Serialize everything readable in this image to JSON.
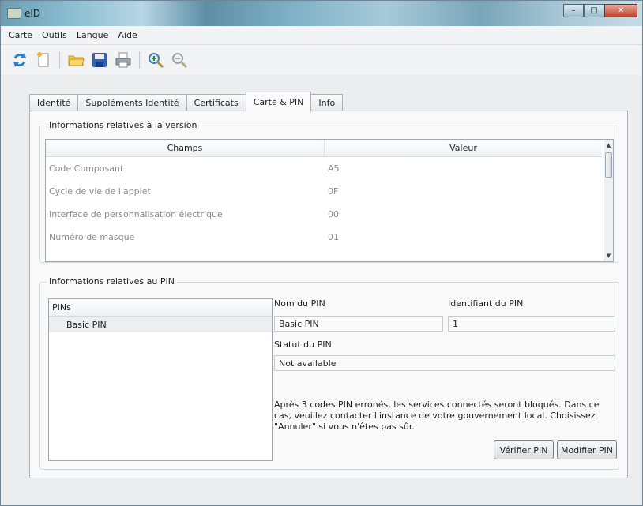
{
  "window": {
    "title": "eID"
  },
  "colors": {
    "titlebar": "#6a9fb2",
    "close_button": "#c1432d",
    "panel": "#f9f9f9"
  },
  "menu": {
    "items": [
      "Carte",
      "Outils",
      "Langue",
      "Aide"
    ]
  },
  "toolbar": {
    "icons": [
      "refresh-icon",
      "new-file-icon",
      "open-folder-icon",
      "save-icon",
      "print-icon",
      "zoom-in-icon",
      "zoom-out-icon"
    ]
  },
  "tabs": [
    {
      "label": "Identité",
      "active": false
    },
    {
      "label": "Suppléments Identité",
      "active": false
    },
    {
      "label": "Certificats",
      "active": false
    },
    {
      "label": "Carte & PIN",
      "active": true
    },
    {
      "label": "Info",
      "active": false
    }
  ],
  "version_group": {
    "title": "Informations relatives à la version",
    "columns": [
      "Champs",
      "Valeur"
    ],
    "rows": [
      [
        "Code Composant",
        "A5"
      ],
      [
        "Cycle de vie de l'applet",
        "0F"
      ],
      [
        "Interface de personnalisation électrique",
        "00"
      ],
      [
        "Numéro de masque",
        "01"
      ]
    ]
  },
  "pin_group": {
    "title": "Informations relatives au PIN",
    "list_header": "PINs",
    "list_items": [
      "Basic PIN"
    ],
    "name_label": "Nom du PIN",
    "name_value": "Basic PIN",
    "id_label": "Identifiant du PIN",
    "id_value": "1",
    "status_label": "Statut du PIN",
    "status_value": "Not available",
    "warning": "Après 3 codes PIN erronés, les services connectés seront bloqués. Dans ce cas, veuillez contacter l'instance de votre gouvernement local. Choisissez \"Annuler\" si vous n'êtes pas sûr.",
    "verify_button": "Vérifier PIN",
    "modify_button": "Modifier PIN"
  }
}
